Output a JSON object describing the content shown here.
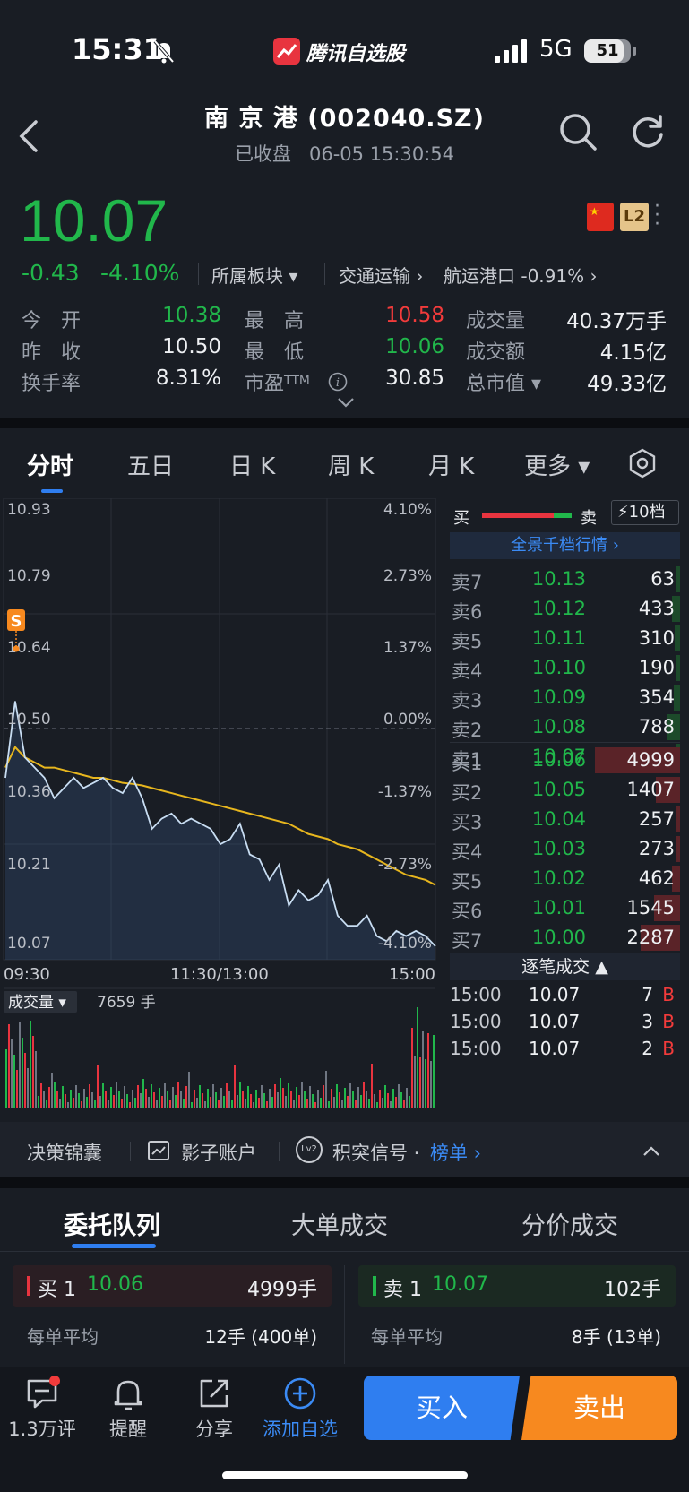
{
  "status": {
    "time": "15:31",
    "app_name": "腾讯自选股",
    "network": "5G",
    "battery": "51"
  },
  "header": {
    "title": "南 京 港 (002040.SZ)",
    "subtitle": "已收盘   06-05 15:30:54"
  },
  "quote": {
    "last": "10.07",
    "change": "-0.43",
    "change_pct": "-4.10%",
    "l2": "L2",
    "sector_menu": "所属板块 ▾",
    "industry": "交通运输 ›",
    "subindustry": "航运港口 -0.91% ›",
    "stats": [
      {
        "label": "今　开",
        "value": "10.38",
        "color": "#21b74b"
      },
      {
        "label": "最　高",
        "value": "10.58",
        "color": "#f23b3b"
      },
      {
        "label": "成交量",
        "value": "40.37万手",
        "color": "#eef0f3"
      },
      {
        "label": "昨　收",
        "value": "10.50",
        "color": "#eef0f3"
      },
      {
        "label": "最　低",
        "value": "10.06",
        "color": "#21b74b"
      },
      {
        "label": "成交额",
        "value": "4.15亿",
        "color": "#eef0f3"
      },
      {
        "label": "换手率",
        "value": "8.31%",
        "color": "#eef0f3"
      },
      {
        "label": "市盈ᵀᵀᴹ",
        "value": "30.85",
        "color": "#eef0f3"
      },
      {
        "label": "总市值 ▾",
        "value": "49.33亿",
        "color": "#eef0f3"
      }
    ]
  },
  "tabs": [
    "分时",
    "五日",
    "日 K",
    "周 K",
    "月 K",
    "更多 ▾"
  ],
  "chart": {
    "y_labels_left": [
      "10.93",
      "10.79",
      "10.64",
      "10.50",
      "10.36",
      "10.21",
      "10.07"
    ],
    "y_labels_right": [
      "4.10%",
      "2.73%",
      "1.37%",
      "0.00%",
      "-1.37%",
      "-2.73%",
      "-4.10%"
    ],
    "x_labels": [
      "09:30",
      "11:30/13:00",
      "15:00"
    ],
    "marker": "S",
    "volume_label": "成交量 ▾",
    "volume_value": "7659 手"
  },
  "chart_data": {
    "type": "line",
    "title": "",
    "ylim": [
      10.07,
      10.93
    ],
    "prev_close": 10.5,
    "series": [
      {
        "values": [
          10.4,
          10.55,
          10.44,
          10.42,
          10.4,
          10.36,
          10.38,
          10.4,
          10.38,
          10.39,
          10.4,
          10.38,
          10.37,
          10.4,
          10.36,
          10.3,
          10.32,
          10.33,
          10.31,
          10.32,
          10.31,
          10.3,
          10.27,
          10.28,
          10.31,
          10.25,
          10.24,
          10.2,
          10.23,
          10.15,
          10.18,
          10.16,
          10.17,
          10.2,
          10.13,
          10.11,
          10.11,
          10.13,
          10.09,
          10.08,
          10.1,
          10.09,
          10.1,
          10.09,
          10.07
        ]
      },
      {
        "values": [
          10.42,
          10.46,
          10.44,
          10.43,
          10.42,
          10.42,
          10.415,
          10.41,
          10.405,
          10.4,
          10.4,
          10.395,
          10.39,
          10.388,
          10.385,
          10.38,
          10.375,
          10.37,
          10.365,
          10.36,
          10.355,
          10.35,
          10.345,
          10.34,
          10.335,
          10.33,
          10.325,
          10.32,
          10.315,
          10.31,
          10.3,
          10.29,
          10.285,
          10.28,
          10.27,
          10.265,
          10.26,
          10.25,
          10.24,
          10.23,
          10.22,
          10.21,
          10.205,
          10.2,
          10.19
        ]
      }
    ]
  },
  "book": {
    "buy_label": "买",
    "sell_label": "卖",
    "levels_btn": "10档",
    "panorama": "全景千档行情 ›",
    "asks": [
      {
        "label": "卖7",
        "price": "10.13",
        "vol": "63",
        "ratio": 0.01
      },
      {
        "label": "卖6",
        "price": "10.12",
        "vol": "433",
        "ratio": 0.09
      },
      {
        "label": "卖5",
        "price": "10.11",
        "vol": "310",
        "ratio": 0.06
      },
      {
        "label": "卖4",
        "price": "10.10",
        "vol": "190",
        "ratio": 0.04
      },
      {
        "label": "卖3",
        "price": "10.09",
        "vol": "354",
        "ratio": 0.07
      },
      {
        "label": "卖2",
        "price": "10.08",
        "vol": "788",
        "ratio": 0.16
      },
      {
        "label": "卖1",
        "price": "10.07",
        "vol": "102",
        "ratio": 0.02
      }
    ],
    "bids": [
      {
        "label": "买1",
        "price": "10.06",
        "vol": "4999",
        "ratio": 1.0
      },
      {
        "label": "买2",
        "price": "10.05",
        "vol": "1407",
        "ratio": 0.28
      },
      {
        "label": "买3",
        "price": "10.04",
        "vol": "257",
        "ratio": 0.05
      },
      {
        "label": "买4",
        "price": "10.03",
        "vol": "273",
        "ratio": 0.05
      },
      {
        "label": "买5",
        "price": "10.02",
        "vol": "462",
        "ratio": 0.09
      },
      {
        "label": "买6",
        "price": "10.01",
        "vol": "1545",
        "ratio": 0.31
      },
      {
        "label": "买7",
        "price": "10.00",
        "vol": "2287",
        "ratio": 0.46
      }
    ],
    "trades_title": "逐笔成交 ▲",
    "trades": [
      {
        "time": "15:00",
        "price": "10.07",
        "vol": "7",
        "side": "B"
      },
      {
        "time": "15:00",
        "price": "10.07",
        "vol": "3",
        "side": "B"
      },
      {
        "time": "15:00",
        "price": "10.07",
        "vol": "2",
        "side": "B"
      }
    ]
  },
  "strip": {
    "item1": "决策锦囊",
    "item2": "影子账户",
    "item3_prefix": "积突信号 · ",
    "item3_link": "榜单 ›",
    "lv2": "Lv2"
  },
  "queue": {
    "tabs": [
      "委托队列",
      "大单成交",
      "分价成交"
    ],
    "buy": {
      "label": "买 1",
      "price": "10.06",
      "vol": "4999手",
      "avg_label": "每单平均",
      "avg": "12手 (400单)"
    },
    "sell": {
      "label": "卖 1",
      "price": "10.07",
      "vol": "102手",
      "avg_label": "每单平均",
      "avg": "8手 (13单)"
    }
  },
  "footer": {
    "comments": "1.3万评",
    "remind": "提醒",
    "share": "分享",
    "add": "添加自选",
    "buy": "买入",
    "sell": "卖出"
  }
}
